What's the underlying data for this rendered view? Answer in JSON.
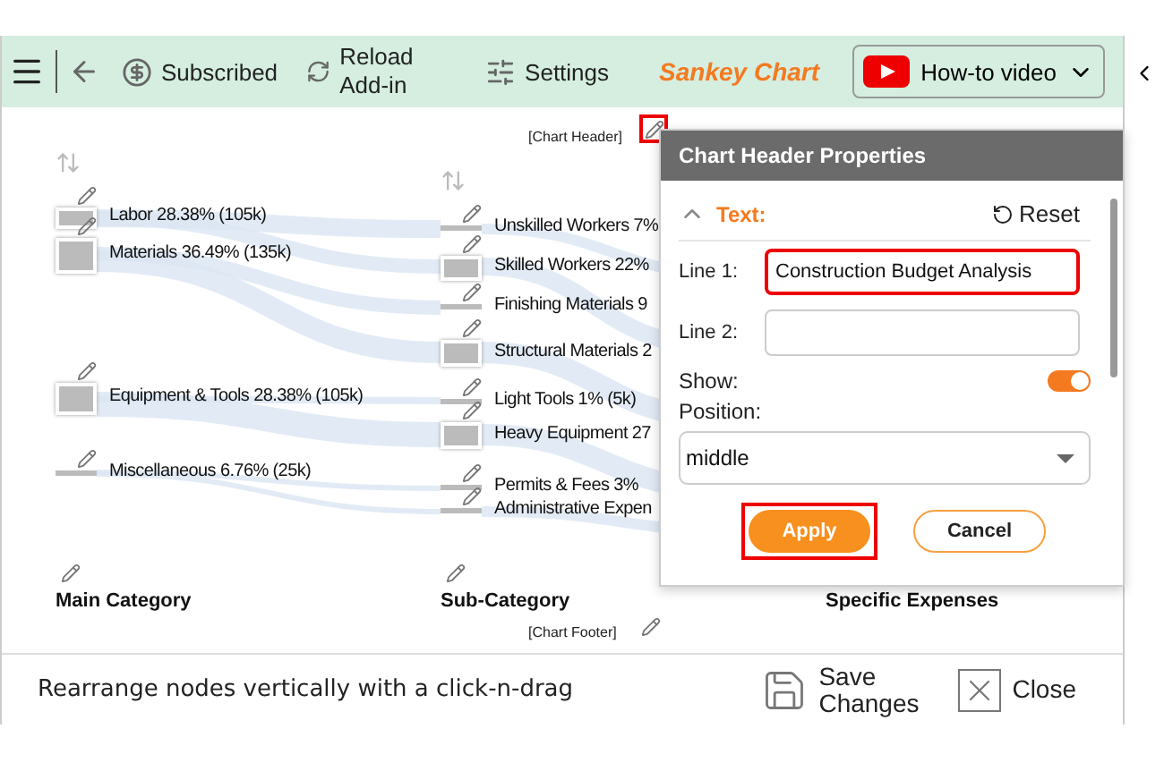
{
  "toolbar": {
    "subscribed": "Subscribed",
    "reload": "Reload Add-in",
    "settings": "Settings",
    "title": "Sankey Chart",
    "video_button": "How-to video"
  },
  "chart": {
    "header": "[Chart Header]",
    "header_edit_highlight": true,
    "footer": "[Chart Footer]",
    "columns": [
      {
        "title": "Main Category",
        "nodes": [
          {
            "label": "Labor 28.38% (105k)",
            "kind": "block"
          },
          {
            "label": "Materials 36.49% (135k)",
            "kind": "block"
          },
          {
            "label": "Equipment & Tools 28.38% (105k)",
            "kind": "block"
          },
          {
            "label": "Miscellaneous 6.76% (25k)",
            "kind": "thin"
          }
        ]
      },
      {
        "title": "Sub-Category",
        "nodes": [
          {
            "label": "Unskilled Workers 7%",
            "kind": "thin"
          },
          {
            "label": "Skilled Workers 22%",
            "kind": "block"
          },
          {
            "label": "Finishing Materials 9",
            "kind": "thin"
          },
          {
            "label": "Structural Materials 2",
            "kind": "block"
          },
          {
            "label": "Light Tools 1% (5k)",
            "kind": "thin"
          },
          {
            "label": "Heavy Equipment 27",
            "kind": "block"
          },
          {
            "label": "Permits & Fees 3%",
            "kind": "thin"
          },
          {
            "label": "Administrative Expen",
            "kind": "thin"
          }
        ]
      },
      {
        "title": "Specific Expenses"
      }
    ]
  },
  "popup": {
    "title": "Chart Header Properties",
    "section": "Text:",
    "expanded": true,
    "reset": "Reset",
    "line1": {
      "label": "Line 1:",
      "value": "Construction Budget Analysis",
      "highlight": true
    },
    "line2": {
      "label": "Line 2:"
    },
    "show": {
      "label": "Show:",
      "on": true
    },
    "position": {
      "label": "Position:",
      "value": "middle"
    },
    "apply": {
      "label": "Apply",
      "highlight": true
    },
    "cancel": "Cancel"
  },
  "status": {
    "hint": "Rearrange nodes vertically with a click-n-drag",
    "save": "Save Changes",
    "close": "Close"
  }
}
